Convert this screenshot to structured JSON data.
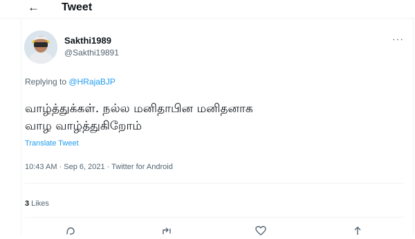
{
  "header": {
    "back_icon": "arrow-left-icon",
    "title": "Tweet"
  },
  "author": {
    "display_name": "Sakthi1989",
    "handle": "@Sakthi19891",
    "more_icon": "more-icon"
  },
  "replying": {
    "prefix": "Replying to ",
    "mention": "@HRajaBJP"
  },
  "tweet": {
    "line1": "வாழ்த்துக்கள். நல்ல மனிதாபின மனிதனாக",
    "line2": "வாழ வாழ்த்துகிறோம்",
    "translate": "Translate Tweet"
  },
  "meta": {
    "text": "10:43 AM · Sep 6, 2021 · Twitter for Android"
  },
  "stats": {
    "likes_count": "3",
    "likes_label": " Likes"
  },
  "actions": [
    "reply-icon",
    "retweet-icon",
    "like-icon",
    "share-icon"
  ],
  "colors": {
    "accent": "#1d9bf0",
    "secondary_text": "#536471",
    "border": "#eff3f4"
  }
}
